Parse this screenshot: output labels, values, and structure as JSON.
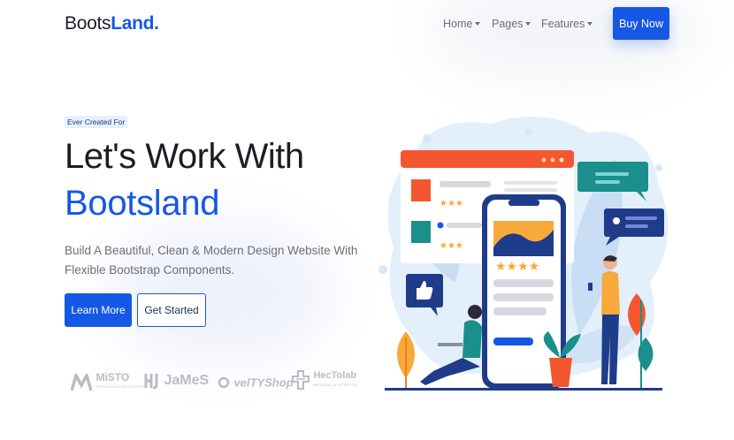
{
  "nav": {
    "logo_prefix": "Boots",
    "logo_suffix": "Land.",
    "menu": [
      {
        "label": "Home"
      },
      {
        "label": "Pages"
      },
      {
        "label": "Features"
      }
    ],
    "cta": "Buy Now"
  },
  "hero": {
    "tag": "Ever Created For",
    "title_line1": "Let's Work With",
    "title_line2": "Bootsland",
    "description": "Build A Beautiful, Clean & Modern Design Website With Flexible Bootstrap Components.",
    "primary_button": "Learn More",
    "secondary_button": "Get Started"
  },
  "brands": [
    {
      "name": "MiSTO",
      "sub": "DESIGNING SOLUTIONS"
    },
    {
      "name": "JaMeS"
    },
    {
      "name": "velTYShop"
    },
    {
      "name": "HecTolab",
      "sub": "MEDICAL & HOSPITAL"
    }
  ],
  "colors": {
    "accent": "#1658e6",
    "illustration_orange": "#f4572f",
    "illustration_teal": "#1a8f8c",
    "illustration_navy": "#1f3c8a",
    "illustration_yellow": "#f7a93a"
  }
}
